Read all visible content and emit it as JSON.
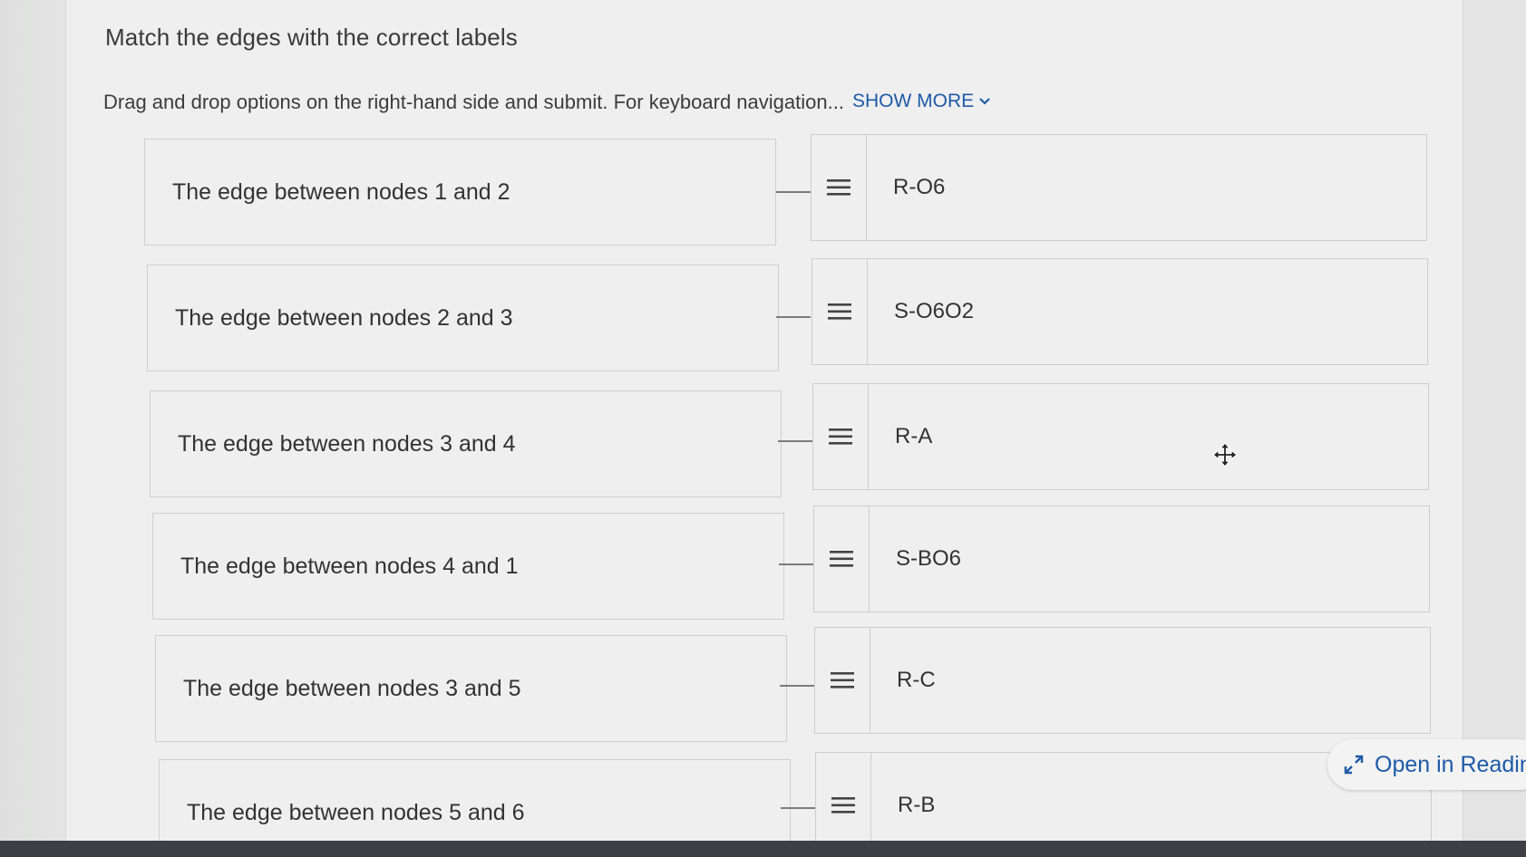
{
  "title": "Match the edges with the correct labels",
  "instructions": "Drag and drop options on the right-hand side and submit. For keyboard navigation...",
  "show_more": "SHOW MORE",
  "prompts": [
    "The edge between nodes 1 and 2",
    "The edge between nodes 2 and 3",
    "The edge between nodes 3 and 4",
    "The edge between nodes 4 and 1",
    "The edge between nodes 3 and 5",
    "The edge between nodes 5 and 6"
  ],
  "answers": [
    "R-O6",
    "S-O6O2",
    "R-A",
    "S-BO6",
    "R-C",
    "R-B"
  ],
  "reading_button": "Open in Readin",
  "colors": {
    "link": "#1e5aa8",
    "text": "#333333",
    "border": "#cdcdcd"
  },
  "icons": {
    "handle": "drag-handle-icon",
    "chevron": "chevron-down-icon",
    "expand": "expand-icon",
    "cursor": "move-cursor-icon"
  }
}
